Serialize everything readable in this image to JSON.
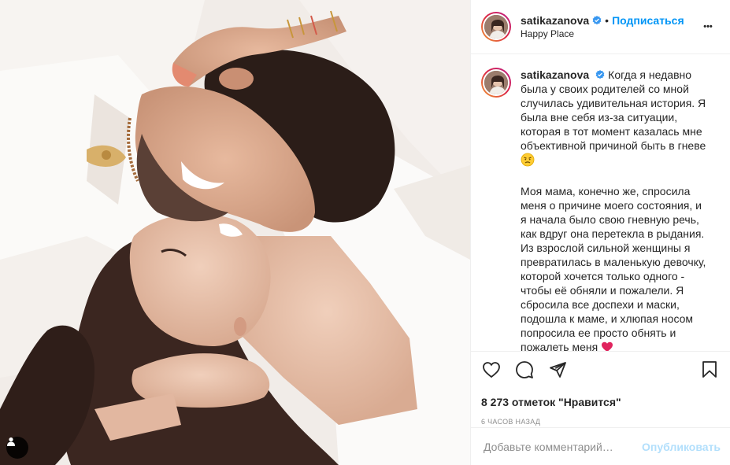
{
  "post": {
    "username": "satikazanova",
    "follow_label": "Подписаться",
    "separator": "•",
    "location": "Happy Place",
    "more_label": "•••",
    "caption": {
      "username": "satikazanova",
      "paragraph1": "Когда я недавно была у своих родителей со мной случилась удивительная история. Я была вне себя из-за ситуации, которая в тот момент казалась мне объективной причиной быть в гневе",
      "paragraph2": "Моя мама, конечно же, спросила меня о причине моего состояния, и я начала было свою гневную речь, как вдруг она перетекла в рыдания. Из взрослой сильной женщины я превратилась в маленькую девочку, которой хочется только одного - чтобы её обняли и пожалели. Я сбросила все доспехи и маски, подошла к маме, и хлюпая носом попросила ее просто обнять и пожалеть меня"
    },
    "likes": "8 273 отметок \"Нравится\"",
    "time": "6 часов назад",
    "comment_placeholder": "Добавьте комментарий…",
    "publish_label": "Опубликовать"
  },
  "icons": {
    "like": "heart-icon",
    "comment": "comment-icon",
    "share": "paper-plane-icon",
    "save": "bookmark-icon",
    "verified": "verified-badge-icon",
    "tag": "user-tag-icon"
  },
  "colors": {
    "accent": "#0095f6",
    "publish_disabled": "#b2dffc",
    "muted": "#8e8e8e",
    "border": "#efefef"
  }
}
